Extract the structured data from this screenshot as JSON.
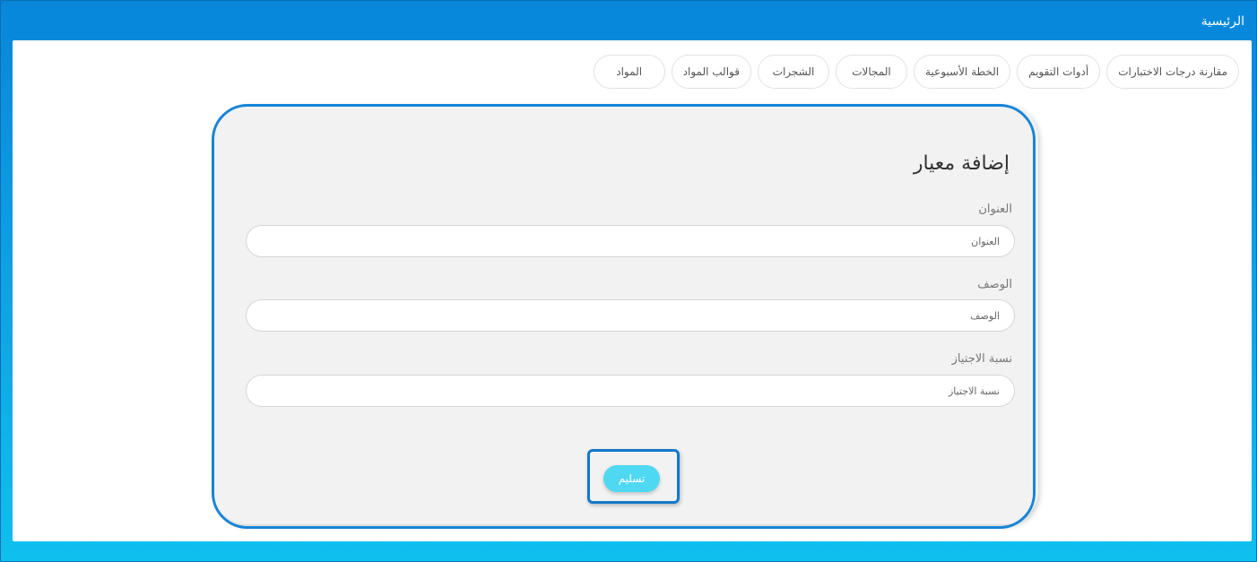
{
  "header": {
    "home_label": "الرئيسية"
  },
  "tabs": [
    {
      "label": "المواد"
    },
    {
      "label": "قوالب المواد"
    },
    {
      "label": "الشجرات"
    },
    {
      "label": "المجالات"
    },
    {
      "label": "الخطة الأسبوعية"
    },
    {
      "label": "أدوات التقويم"
    },
    {
      "label": "مقارنة درجات الاختبارات"
    }
  ],
  "form": {
    "title": "إضافة معيار",
    "title_field": {
      "label": "العنوان",
      "placeholder": "العنوان",
      "value": ""
    },
    "description_field": {
      "label": "الوصف",
      "placeholder": "الوصف",
      "value": ""
    },
    "pass_rate_field": {
      "label": "نسبة الاجتياز",
      "placeholder": "نسبة الاجتياز",
      "value": ""
    },
    "submit_label": "تسليم"
  },
  "colors": {
    "header_bg": "#0788db",
    "outline": "#1785d6",
    "submit_bg": "#4fd8f2",
    "card_bg": "#f2f2f2"
  }
}
